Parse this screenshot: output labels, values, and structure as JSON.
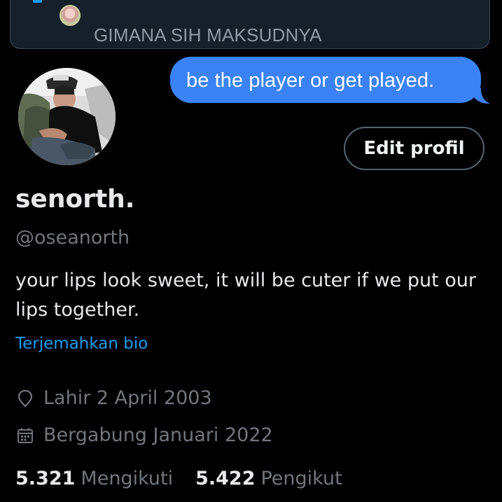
{
  "banner": {
    "text": "GIMANA SIH MAKSUDNYA"
  },
  "chat": {
    "message": "be the player or get played."
  },
  "profile": {
    "edit_button_label": "Edit profil",
    "display_name": "senorth.",
    "handle": "@oseanorth",
    "bio": "your lips look sweet, it will be cuter if we put our lips together.",
    "translate_label": "Terjemahkan bio",
    "birth_text": "Lahir 2 April 2003",
    "joined_text": "Bergabung Januari 2022",
    "following_count": "5.321",
    "following_label": "Mengikuti",
    "followers_count": "5.422",
    "followers_label": "Pengikut"
  },
  "icons": {
    "birth": "map-pin-icon",
    "joined": "calendar-icon"
  },
  "colors": {
    "background": "#000000",
    "accent": "#1d9bf0",
    "chat_bubble": "#3b82f6",
    "secondary_text": "#71767b",
    "primary_text": "#e7e9ea",
    "banner_bg": "#15202b"
  }
}
